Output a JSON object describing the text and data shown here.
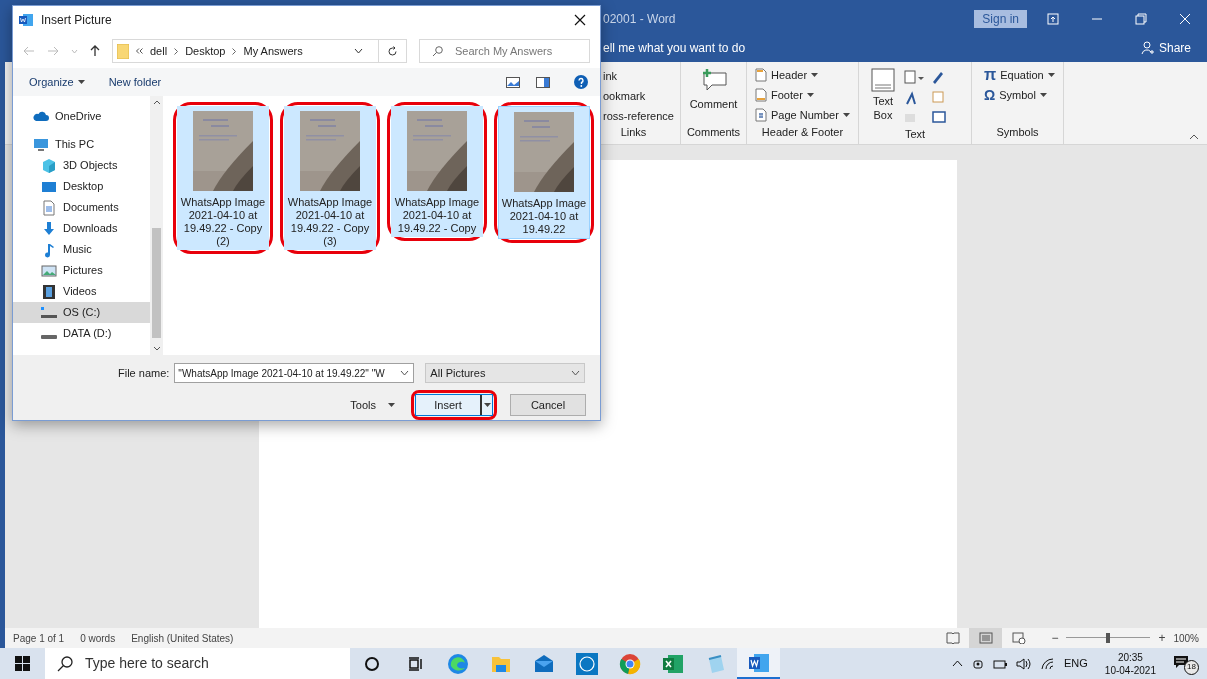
{
  "word": {
    "title": "02001  -  Word",
    "sign_in": "Sign in",
    "tell_me": "ell me what you want to do",
    "share": "Share",
    "links": {
      "label": "Links",
      "items": [
        "ink",
        "ookmark",
        "ross-reference"
      ]
    },
    "comments": {
      "label": "Comments",
      "button": "Comment"
    },
    "header_footer": {
      "label": "Header & Footer",
      "items": [
        {
          "kind": "header",
          "label": "Header"
        },
        {
          "kind": "footer",
          "label": "Footer"
        },
        {
          "kind": "page-number",
          "label": "Page Number"
        }
      ]
    },
    "text": {
      "label": "Text",
      "text_box": [
        "Text",
        "Box"
      ]
    },
    "symbols": {
      "label": "Symbols",
      "items": [
        {
          "kind": "equation",
          "glyph": "π",
          "label": "Equation"
        },
        {
          "kind": "symbol",
          "glyph": "Ω",
          "label": "Symbol"
        }
      ]
    }
  },
  "status_bar": {
    "page": "Page 1 of 1",
    "words": "0 words",
    "language": "English (United States)",
    "views": [
      {
        "kind": "read",
        "selected": false
      },
      {
        "kind": "print",
        "selected": true
      },
      {
        "kind": "web",
        "selected": false
      }
    ],
    "zoom": {
      "minus": "−",
      "plus": "+",
      "level": 0.5,
      "reading": "100%"
    }
  },
  "dialog": {
    "title": "Insert Picture",
    "path": [
      "dell",
      "Desktop",
      "My Answers"
    ],
    "search": {
      "placeholder": "Search My Answers"
    },
    "organize": "Organize",
    "new_folder": "New folder",
    "nav": [
      {
        "kind": "cloud",
        "label": "OneDrive",
        "selected": false
      },
      {
        "kind": "pc",
        "label": "This PC",
        "selected": false,
        "children": [
          {
            "kind": "cube",
            "label": "3D Objects",
            "selected": false
          },
          {
            "kind": "desktop",
            "label": "Desktop",
            "selected": false
          },
          {
            "kind": "document",
            "label": "Documents",
            "selected": false
          },
          {
            "kind": "download",
            "label": "Downloads",
            "selected": false
          },
          {
            "kind": "music",
            "label": "Music",
            "selected": false
          },
          {
            "kind": "pictures",
            "label": "Pictures",
            "selected": false
          },
          {
            "kind": "video",
            "label": "Videos",
            "selected": false
          },
          {
            "kind": "os-drive",
            "label": "OS (C:)",
            "selected": true
          },
          {
            "kind": "drive",
            "label": "DATA (D:)",
            "selected": false
          }
        ]
      }
    ],
    "files": [
      {
        "name": "WhatsApp Image 2021-04-10 at 19.49.22 - Copy (2)",
        "selected": true,
        "circled": true
      },
      {
        "name": "WhatsApp Image 2021-04-10 at 19.49.22 - Copy (3)",
        "selected": true,
        "circled": true
      },
      {
        "name": "WhatsApp Image 2021-04-10 at 19.49.22 - Copy",
        "selected": true,
        "circled": true
      },
      {
        "name": "WhatsApp Image 2021-04-10 at 19.49.22",
        "selected": true,
        "circled": true
      }
    ],
    "file_name_label": "File name:",
    "file_name": "\"WhatsApp Image 2021-04-10 at 19.49.22\" \"W",
    "filter": "All Pictures",
    "tools": "Tools",
    "insert": {
      "label": "Insert",
      "circled": true
    },
    "cancel": "Cancel"
  },
  "taskbar": {
    "search": {
      "placeholder": "Type here to search"
    },
    "apps": [
      {
        "kind": "cortana",
        "selected": false
      },
      {
        "kind": "task-view",
        "selected": false
      },
      {
        "kind": "edge",
        "selected": false
      },
      {
        "kind": "explorer",
        "selected": false
      },
      {
        "kind": "mail",
        "selected": false
      },
      {
        "kind": "dell",
        "selected": false
      },
      {
        "kind": "chrome",
        "selected": false
      },
      {
        "kind": "excel",
        "selected": false
      },
      {
        "kind": "notepad",
        "selected": false
      },
      {
        "kind": "word",
        "selected": true
      }
    ],
    "language": "ENG",
    "time": "20:35",
    "date": "10-04-2021",
    "notifications": "18"
  }
}
